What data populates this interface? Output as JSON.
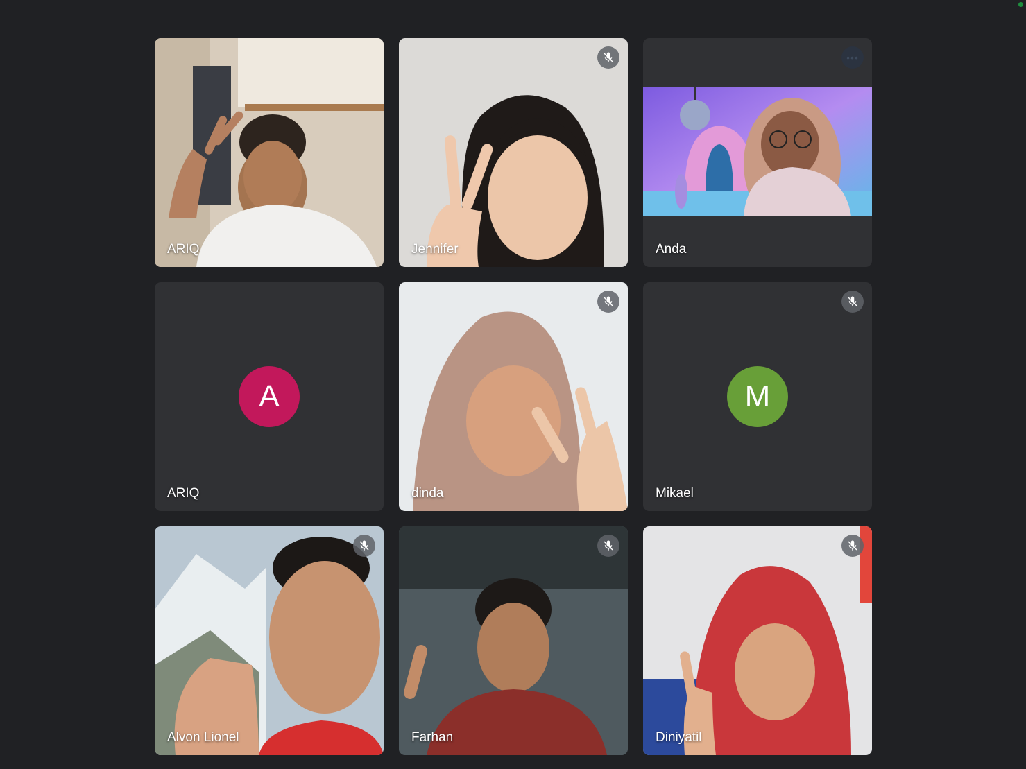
{
  "meeting": {
    "status_indicator": "green",
    "participants": [
      {
        "name": "ARIQ",
        "camera": "on",
        "muted": false
      },
      {
        "name": "Jennifer",
        "camera": "on",
        "muted": true
      },
      {
        "name": "Anda",
        "camera": "on",
        "muted": false,
        "more_options_icon": "more-horiz-icon"
      },
      {
        "name": "ARIQ",
        "camera": "off",
        "muted": false,
        "avatar_letter": "A",
        "avatar_color": "#c2185b"
      },
      {
        "name": "dinda",
        "camera": "on",
        "muted": true
      },
      {
        "name": "Mikael",
        "camera": "off",
        "muted": true,
        "avatar_letter": "M",
        "avatar_color": "#689f38"
      },
      {
        "name": "Alvon Lionel",
        "camera": "on",
        "muted": true
      },
      {
        "name": "Farhan",
        "camera": "on",
        "muted": true
      },
      {
        "name": "Diniyatil",
        "camera": "on",
        "muted": true
      }
    ]
  },
  "icons": {
    "muted": "mic-off-icon",
    "more": "more-horiz-icon"
  },
  "colors": {
    "background": "#202124",
    "tile_off": "#303134",
    "mute_badge": "#5f6368",
    "name_text": "#ffffff"
  }
}
